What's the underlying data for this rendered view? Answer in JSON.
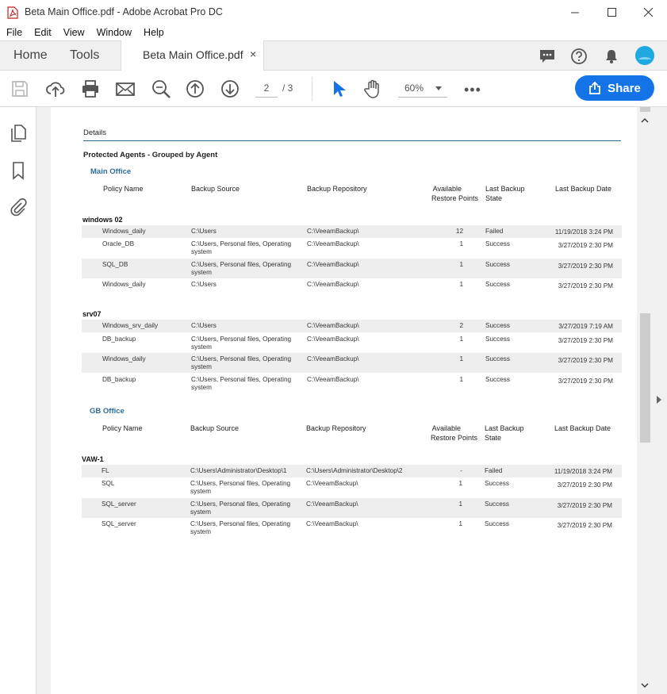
{
  "window": {
    "title": "Beta Main Office.pdf - Adobe Acrobat Pro DC"
  },
  "menu": [
    "File",
    "Edit",
    "View",
    "Window",
    "Help"
  ],
  "tabs": {
    "home": "Home",
    "tools": "Tools",
    "document": "Beta Main Office.pdf",
    "close": "×"
  },
  "toolbar": {
    "page_current": "2",
    "page_total": "/ 3",
    "zoom": "60%",
    "more": "•••",
    "share_label": "Share"
  },
  "colors": {
    "accent": "#1473e6",
    "office_heading": "#2e6d99",
    "details_rule": "#2c6e8a"
  },
  "report": {
    "details_title": "Details",
    "group_title": "Protected Agents - Grouped by Agent",
    "columns": {
      "policy": "Policy Name",
      "source": "Backup Source",
      "repo": "Backup Repository",
      "points_1": "Available",
      "points_2": "Restore Points",
      "state_1": "Last Backup",
      "state_2": "State",
      "date": "Last  Backup Date"
    },
    "offices": [
      {
        "name": "Main Office",
        "agents": [
          {
            "name": "windows 02",
            "rows": [
              {
                "policy": "Windows_daily",
                "source_1": "C:\\Users",
                "source_2": "",
                "repo": "C:\\VeeamBackup\\",
                "points": "12",
                "state": "Failed",
                "date": "11/19/2018 3:24 PM"
              },
              {
                "policy": "Oracle_DB",
                "source_1": "C:\\Users, Personal files, Operating",
                "source_2": "system",
                "repo": "C:\\VeeamBackup\\",
                "points": "1",
                "state": "Success",
                "date": "3/27/2019 2:30 PM"
              },
              {
                "policy": "SQL_DB",
                "source_1": "C:\\Users, Personal files, Operating",
                "source_2": "system",
                "repo": "C:\\VeeamBackup\\",
                "points": "1",
                "state": "Success",
                "date": "3/27/2019 2:30 PM"
              },
              {
                "policy": "Windows_daily",
                "source_1": "C:\\Users",
                "source_2": "",
                "repo": "C:\\VeeamBackup\\",
                "points": "1",
                "state": "Success",
                "date": "3/27/2019 2:30 PM"
              }
            ]
          },
          {
            "name": "srv07",
            "rows": [
              {
                "policy": "Windows_srv_daily",
                "source_1": "C:\\Users",
                "source_2": "",
                "repo": "C:\\VeeamBackup\\",
                "points": "2",
                "state": "Success",
                "date": "3/27/2019 7:19 AM"
              },
              {
                "policy": "DB_backup",
                "source_1": "C:\\Users, Personal files, Operating",
                "source_2": "system",
                "repo": "C:\\VeeamBackup\\",
                "points": "1",
                "state": "Success",
                "date": "3/27/2019 2:30 PM"
              },
              {
                "policy": "Windows_daily",
                "source_1": "C:\\Users, Personal files, Operating",
                "source_2": "system",
                "repo": "C:\\VeeamBackup\\",
                "points": "1",
                "state": "Success",
                "date": "3/27/2019 2:30 PM"
              },
              {
                "policy": "DB_backup",
                "source_1": "C:\\Users, Personal files, Operating",
                "source_2": "system",
                "repo": "C:\\VeeamBackup\\",
                "points": "1",
                "state": "Success",
                "date": "3/27/2019 2:30 PM"
              }
            ]
          }
        ]
      },
      {
        "name": "GB Office",
        "agents": [
          {
            "name": "VAW-1",
            "rows": [
              {
                "policy": "FL",
                "source_1": "C:\\Users\\Administrator\\Desktop\\1",
                "source_2": "",
                "repo": "C:\\Users\\Administrator\\Desktop\\2",
                "points": "-",
                "state": "Failed",
                "date": "11/19/2018 3:24 PM"
              },
              {
                "policy": "SQL",
                "source_1": "C:\\Users, Personal files, Operating",
                "source_2": "system",
                "repo": "C:\\VeeamBackup\\",
                "points": "1",
                "state": "Success",
                "date": "3/27/2019 2:30 PM"
              },
              {
                "policy": "SQL_server",
                "source_1": "C:\\Users, Personal files, Operating",
                "source_2": "system",
                "repo": "C:\\VeeamBackup\\",
                "points": "1",
                "state": "Success",
                "date": "3/27/2019 2:30 PM"
              },
              {
                "policy": "SQL_server",
                "source_1": "C:\\Users, Personal files, Operating",
                "source_2": "system",
                "repo": "C:\\VeeamBackup\\",
                "points": "1",
                "state": "Success",
                "date": "3/27/2019 2:30 PM"
              }
            ]
          }
        ]
      }
    ]
  }
}
